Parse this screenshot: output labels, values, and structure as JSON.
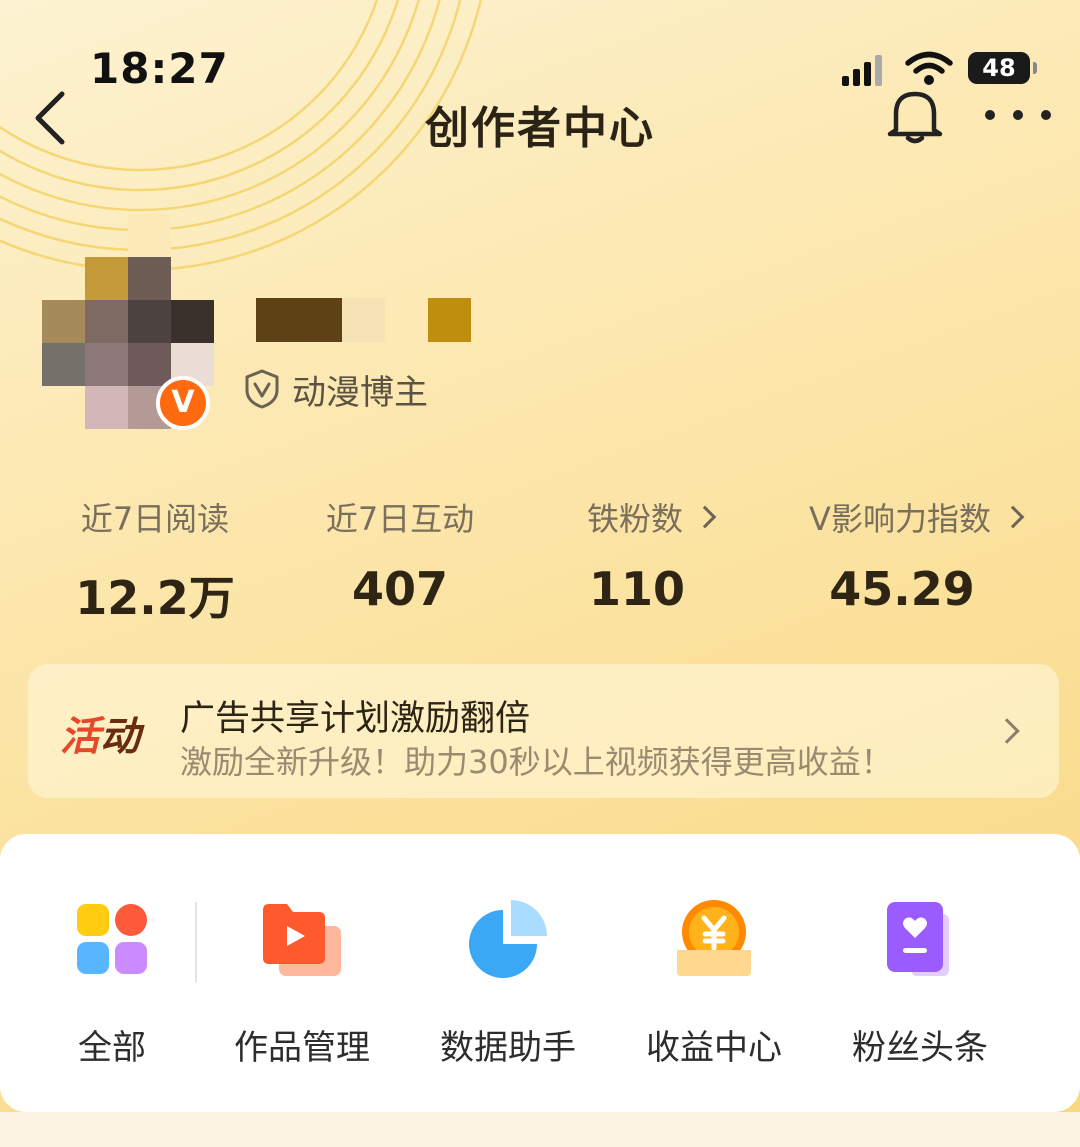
{
  "status_bar": {
    "time": "18:27",
    "battery": "48"
  },
  "header": {
    "title": "创作者中心"
  },
  "profile": {
    "badge_letter": "V",
    "tag": "动漫博主"
  },
  "stats": [
    {
      "label": "近7日阅读",
      "value": "12.2万"
    },
    {
      "label": "近7日互动",
      "value": "407"
    },
    {
      "label": "铁粉数",
      "value": "110"
    },
    {
      "label": "V影响力指数",
      "value": "45.29"
    }
  ],
  "banner": {
    "tag_part1": "活",
    "tag_part2": "动",
    "title": "广告共享计划激励翻倍",
    "subtitle": "激励全新升级！助力30秒以上视频获得更高收益！"
  },
  "tools": [
    {
      "label": "全部",
      "icon": "grid-icon"
    },
    {
      "label": "作品管理",
      "icon": "video-folder-icon"
    },
    {
      "label": "数据助手",
      "icon": "pie-chart-icon"
    },
    {
      "label": "收益中心",
      "icon": "yuan-coin-icon"
    },
    {
      "label": "粉丝头条",
      "icon": "heart-book-icon"
    }
  ],
  "colors": {
    "accent_orange": "#ff6a10",
    "banner_tag_red": "#e8472a",
    "background_yellow": "#fce9b4"
  }
}
